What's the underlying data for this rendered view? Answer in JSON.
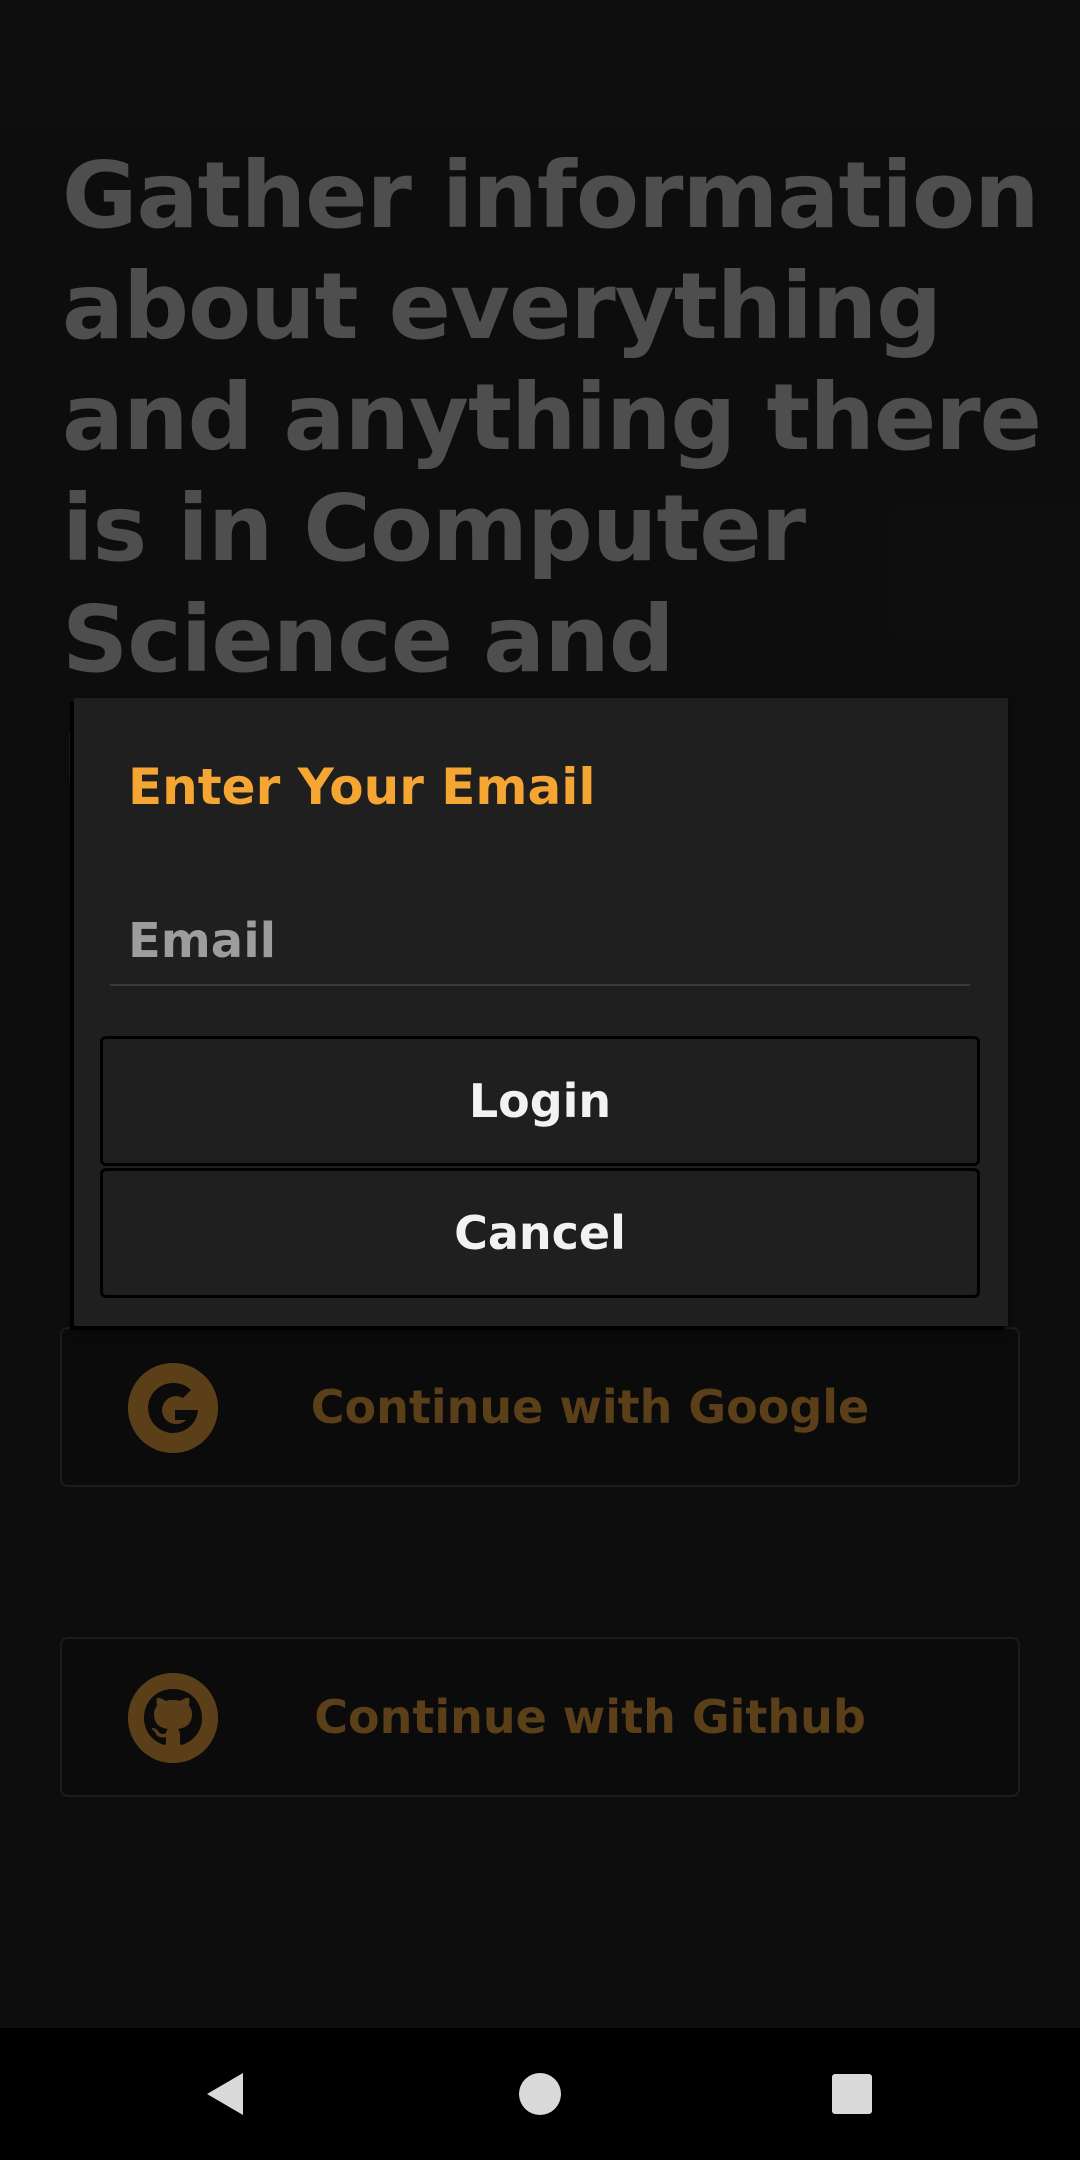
{
  "background": {
    "hero_title": "Gather information about everything and anything there is in Computer Science and related fields",
    "google_button_label": "Continue with Google",
    "github_button_label": "Continue with Github",
    "google_icon": "google-icon",
    "github_icon": "github-icon"
  },
  "dialog": {
    "title": "Enter Your Email",
    "email_placeholder": "Email",
    "email_value": "",
    "login_label": "Login",
    "cancel_label": "Cancel"
  },
  "nav_bar": {
    "icons": [
      "back-icon",
      "home-icon",
      "recents-icon"
    ]
  },
  "colors": {
    "accent": "#f5a531",
    "dimmed_accent": "#6a4a1e",
    "background": "#101010",
    "dialog_background": "#1f1f1f"
  }
}
